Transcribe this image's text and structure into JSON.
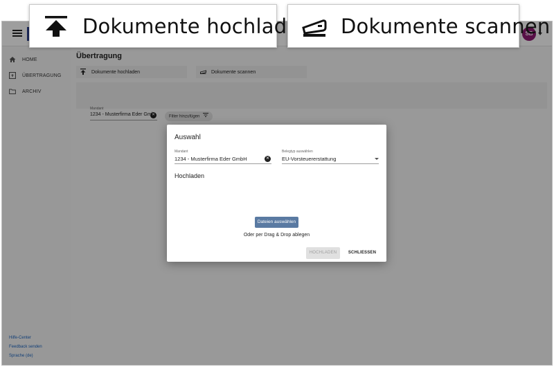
{
  "callouts": {
    "upload": "Dokumente hochladen",
    "scan": "Dokumente scannen"
  },
  "appbar": {
    "avatar_initials": "SB",
    "accent_color": "#8e1a73"
  },
  "sidebar": {
    "items": [
      {
        "label": "HOME",
        "icon": "home-icon"
      },
      {
        "label": "ÜBERTRAGUNG",
        "icon": "upload-box-icon"
      },
      {
        "label": "ARCHIV",
        "icon": "folder-icon"
      }
    ],
    "footer": [
      "Hilfe-Center",
      "Feedback senden",
      "Sprache (de)"
    ]
  },
  "main": {
    "title": "Übertragung",
    "tabs": [
      {
        "label": "Dokumente hochladen",
        "icon": "upload-icon"
      },
      {
        "label": "Dokumente scannen",
        "icon": "scanner-icon"
      }
    ],
    "filter": {
      "mandant_label": "Mandant",
      "mandant_value": "1234 - Musterfirma Eder Gml",
      "add_filter": "Filter hinzufügen"
    }
  },
  "dialog": {
    "title": "Auswahl",
    "mandant_label": "Mandant",
    "mandant_value": "1234 - Musterfirma Eder GmbH",
    "belegtyp_label": "Belegtyp auswählen",
    "belegtyp_value": "EU-Vorsteuererstattung",
    "section": "Hochladen",
    "choose_files": "Dateien auswählen",
    "drag_drop": "Oder per Drag & Drop ablegen",
    "upload_button": "HOCHLADEN",
    "close_button": "SCHLIESSEN"
  }
}
